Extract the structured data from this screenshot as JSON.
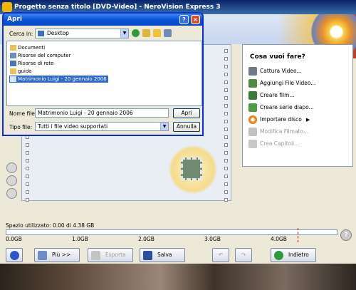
{
  "main_window": {
    "title": "Progetto senza titolo [DVD-Video] - NeroVision Express 3"
  },
  "task_panel": {
    "title": "Cosa vuoi fare?",
    "items": [
      {
        "label": "Cattura Video...",
        "enabled": true,
        "icon": "camera-icon"
      },
      {
        "label": "Aggiungi File Video...",
        "enabled": true,
        "icon": "film-add-icon"
      },
      {
        "label": "Creare film...",
        "enabled": true,
        "icon": "film-create-icon"
      },
      {
        "label": "Creare serie diapo...",
        "enabled": true,
        "icon": "slideshow-icon"
      },
      {
        "label": "Importare disco",
        "enabled": true,
        "icon": "disc-icon",
        "has_submenu": true
      },
      {
        "label": "Modifica Filmato...",
        "enabled": false,
        "icon": "edit-movie-icon"
      },
      {
        "label": "Crea Capitoli...",
        "enabled": false,
        "icon": "chapters-icon"
      }
    ]
  },
  "space": {
    "label": "Spazio utilizzato: 0.00 di 4.38 GB",
    "used_fraction": 0.0,
    "ticks": [
      "0.0GB",
      "1.0GB",
      "2.0GB",
      "3.0GB",
      "4.0GB"
    ]
  },
  "bottom_buttons": {
    "more": "Più >>",
    "export": "Esporta",
    "save": "Salva",
    "back": "Indietro"
  },
  "dialog": {
    "title": "Apri",
    "look_in_label": "Cerca in:",
    "look_in_value": "Desktop",
    "files": [
      {
        "name": "Documenti",
        "icon": "folder-icon"
      },
      {
        "name": "Risorse del computer",
        "icon": "computer-icon"
      },
      {
        "name": "Risorse di rete",
        "icon": "network-icon"
      },
      {
        "name": "guida",
        "icon": "folder-icon"
      },
      {
        "name": "Matrimonio Luigi - 20 gennaio 2006",
        "icon": "video-file-icon",
        "selected": true
      }
    ],
    "file_name_label": "Nome file:",
    "file_name_value": "Matrimonio Luigi - 20 gennaio 2006",
    "file_type_label": "Tipo file:",
    "file_type_value": "Tutti i file video supportati",
    "open_button": "Apri",
    "cancel_button": "Annulla",
    "help_glyph": "?",
    "close_glyph": "×"
  },
  "colors": {
    "dialog_title": "#0a53d9",
    "selection": "#316ac5",
    "space_limit": "#cc0000"
  }
}
